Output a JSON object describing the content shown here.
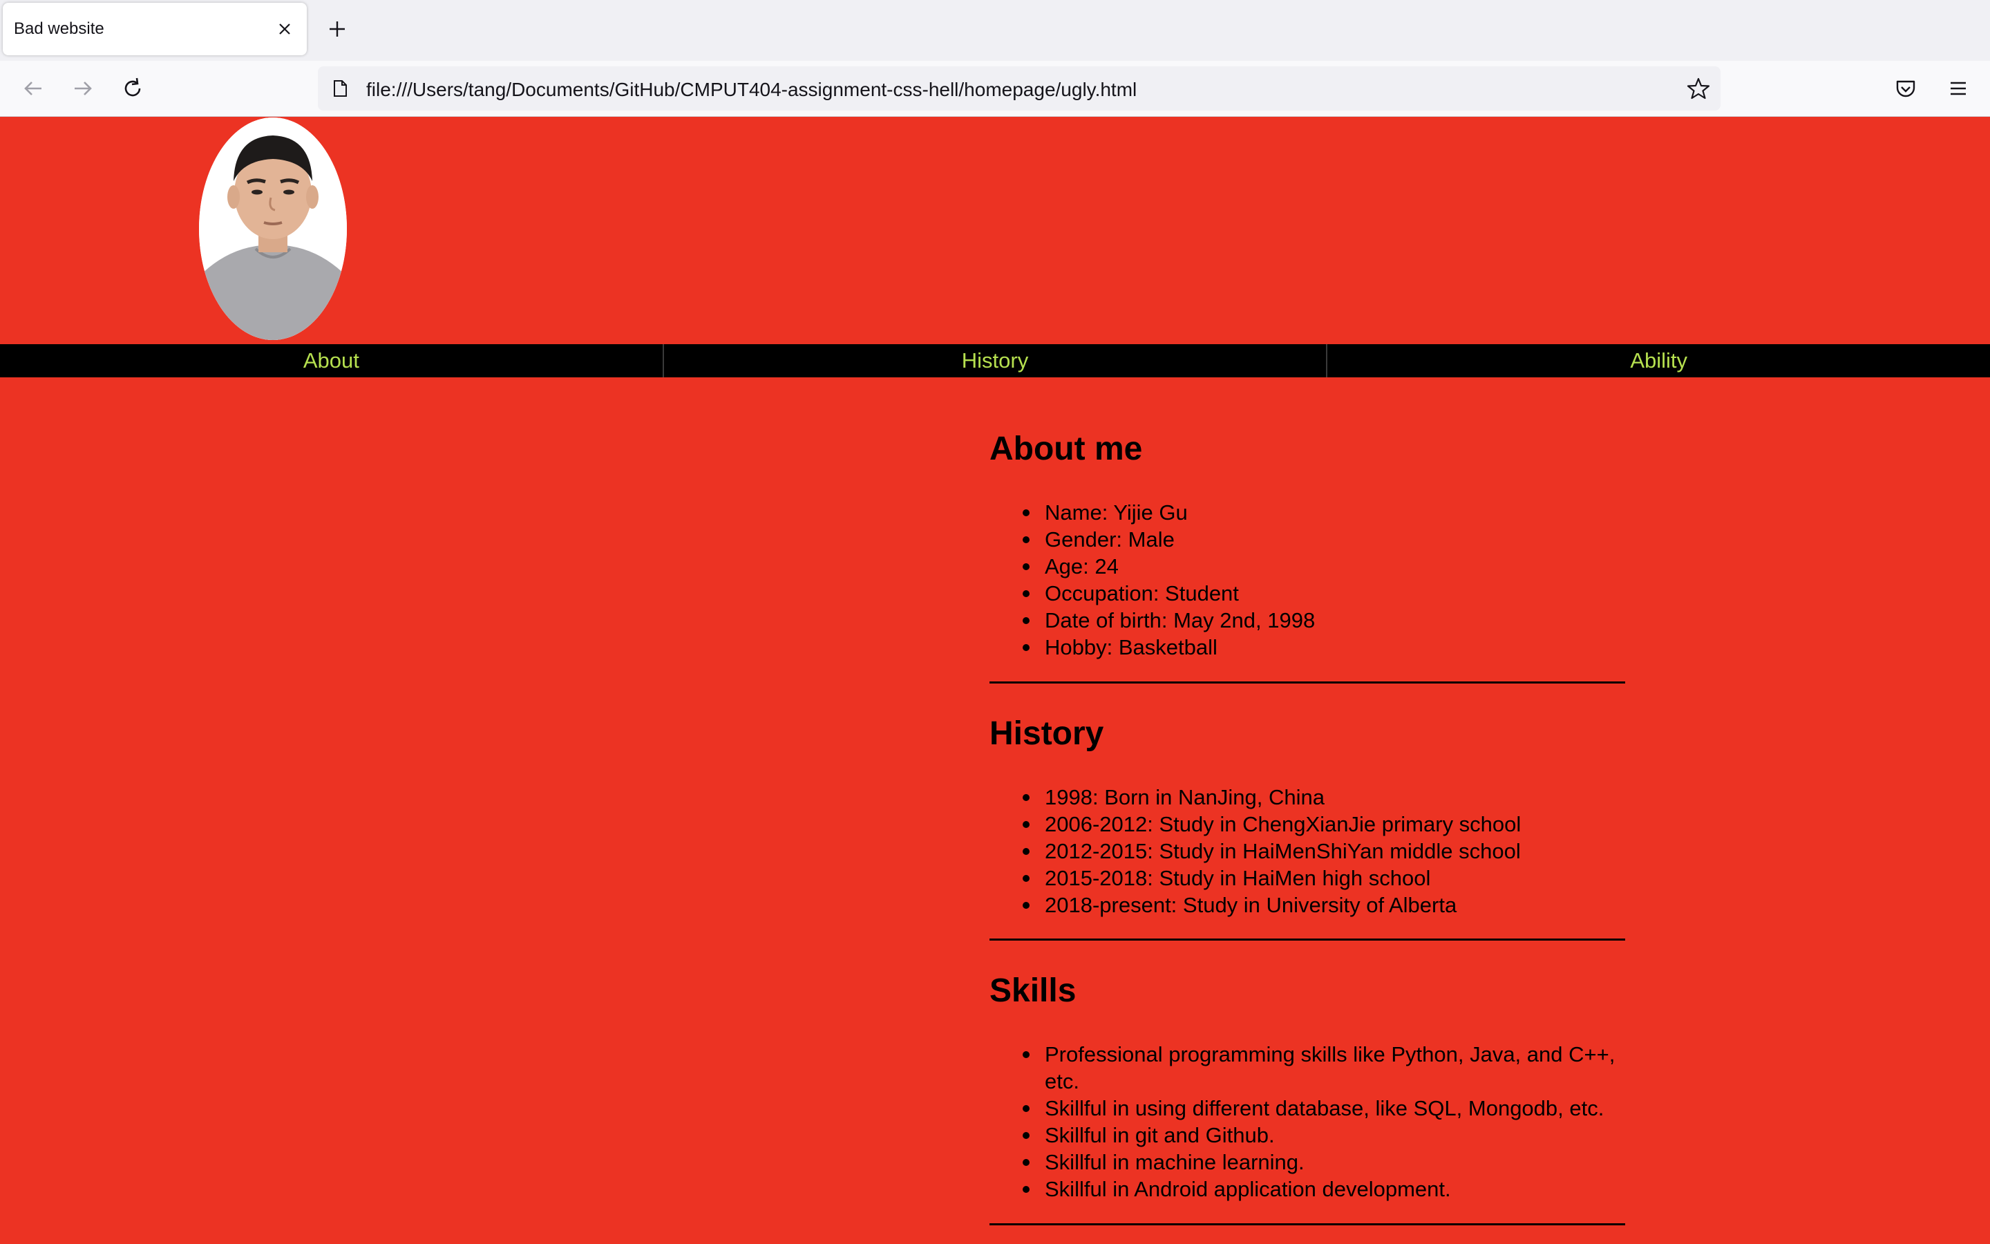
{
  "browser": {
    "tab_title": "Bad website",
    "url": "file:///Users/tang/Documents/GitHub/CMPUT404-assignment-css-hell/homepage/ugly.html"
  },
  "nav": {
    "items": [
      "About",
      "History",
      "Ability"
    ]
  },
  "about": {
    "heading": "About me",
    "items": [
      "Name: Yijie Gu",
      "Gender: Male",
      "Age: 24",
      "Occupation: Student",
      "Date of birth: May 2nd, 1998",
      "Hobby: Basketball"
    ]
  },
  "history": {
    "heading": "History",
    "items": [
      "1998: Born in NanJing, China",
      "2006-2012: Study in ChengXianJie primary school",
      "2012-2015: Study in HaiMenShiYan middle school",
      "2015-2018: Study in HaiMen high school",
      "2018-present: Study in University of Alberta"
    ]
  },
  "skills": {
    "heading": "Skills",
    "items": [
      "Professional programming skills like Python, Java, and C++, etc.",
      "Skillful in using different database, like SQL, Mongodb, etc.",
      "Skillful in git and Github.",
      "Skillful in machine learning.",
      "Skillful in Android application development."
    ]
  },
  "colors": {
    "page_background": "#ec3323",
    "nav_background": "#000000",
    "nav_text": "#b6e04f"
  }
}
